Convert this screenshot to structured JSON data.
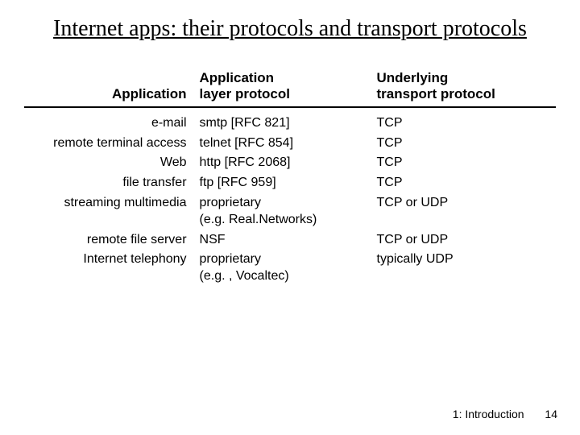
{
  "title": "Internet apps: their protocols and transport protocols",
  "headers": {
    "application": "Application",
    "layer_protocol": "Application\nlayer protocol",
    "transport": "Underlying\ntransport protocol"
  },
  "rows": [
    {
      "app": "e-mail",
      "proto": "smtp [RFC 821]",
      "trans": "TCP"
    },
    {
      "app": "remote terminal access",
      "proto": "telnet [RFC 854]",
      "trans": "TCP"
    },
    {
      "app": "Web",
      "proto": "http [RFC 2068]",
      "trans": "TCP"
    },
    {
      "app": "file transfer",
      "proto": "ftp [RFC 959]",
      "trans": "TCP"
    },
    {
      "app": "streaming multimedia",
      "proto": "proprietary\n(e.g. Real.Networks)",
      "trans": "TCP or UDP"
    },
    {
      "app": "remote file server",
      "proto": "NSF",
      "trans": "TCP or UDP"
    },
    {
      "app": "Internet telephony",
      "proto": "proprietary\n(e.g. , Vocaltec)",
      "trans": "typically UDP"
    }
  ],
  "footer": {
    "section": "1: Introduction",
    "page": "14"
  }
}
